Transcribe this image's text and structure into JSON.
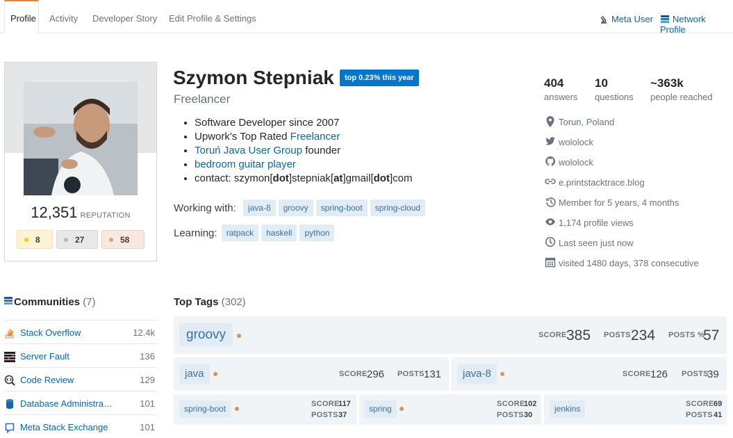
{
  "tabs": [
    "Profile",
    "Activity",
    "Developer Story",
    "Edit Profile & Settings"
  ],
  "header_links": {
    "meta_user": "Meta User",
    "network_profile": "Network Profile"
  },
  "profile": {
    "name": "Szymon Stepniak",
    "top_badge": "top 0.23% this year",
    "title": "Freelancer",
    "reputation": "12,351",
    "reputation_label": "REPUTATION",
    "badges": {
      "gold": "8",
      "silver": "27",
      "bronze": "58"
    }
  },
  "bio": {
    "line1": "Software Developer since 2007",
    "line2_prefix": "Upwork's Top Rated ",
    "line2_link": "Freelancer",
    "line3_link": "Toruń Java User Group",
    "line3_suffix": " founder",
    "line4_link": "bedroom guitar player",
    "line5_a": "contact: szymon[",
    "line5_b": "dot",
    "line5_c": "]stepniak[",
    "line5_d": "at",
    "line5_e": "]gmail[",
    "line5_f": "dot",
    "line5_g": "]com"
  },
  "working_with": {
    "label": "Working with:",
    "tags": [
      "java-8",
      "groovy",
      "spring-boot",
      "spring-cloud"
    ]
  },
  "learning": {
    "label": "Learning:",
    "tags": [
      "ratpack",
      "haskell",
      "python"
    ]
  },
  "stats": [
    {
      "value": "404",
      "label": "answers"
    },
    {
      "value": "10",
      "label": "questions"
    },
    {
      "value": "~363k",
      "label": "people reached"
    }
  ],
  "info": {
    "location": "Torun, Poland",
    "twitter": "wololock",
    "github": "wololock",
    "website": "e.printstacktrace.blog",
    "member": "Member for 5 years, 4 months",
    "views": "1,174 profile views",
    "seen": "Last seen just now",
    "visited": "visited 1480 days, 378 consecutive"
  },
  "communities": {
    "title": "Communities",
    "count": "(7)",
    "items": [
      {
        "name": "Stack Overflow",
        "rep": "12.4k"
      },
      {
        "name": "Server Fault",
        "rep": "136"
      },
      {
        "name": "Code Review",
        "rep": "129"
      },
      {
        "name": "Database Administra…",
        "rep": "101"
      },
      {
        "name": "Meta Stack Exchange",
        "rep": "101"
      }
    ]
  },
  "top_tags": {
    "title": "Top Tags",
    "count": "(302)",
    "score_label": "SCORE",
    "posts_label": "POSTS",
    "posts_pct_label": "POSTS %",
    "main": {
      "tag": "groovy",
      "score": "385",
      "posts": "234",
      "posts_pct": "57"
    },
    "row2": [
      {
        "tag": "java",
        "score": "296",
        "posts": "131"
      },
      {
        "tag": "java-8",
        "score": "126",
        "posts": "39"
      }
    ],
    "row3": [
      {
        "tag": "spring-boot",
        "score": "117",
        "posts": "37"
      },
      {
        "tag": "spring",
        "score": "102",
        "posts": "30"
      },
      {
        "tag": "jenkins",
        "score": "69",
        "posts": "41"
      }
    ]
  },
  "colors": {
    "accent": "#f48024",
    "link": "#0c65a5",
    "tag_bg": "#e1ecf4",
    "tag_fg": "#39739d",
    "gold": "#ffcc01",
    "silver": "#b4b8bc",
    "bronze": "#d1a684"
  }
}
